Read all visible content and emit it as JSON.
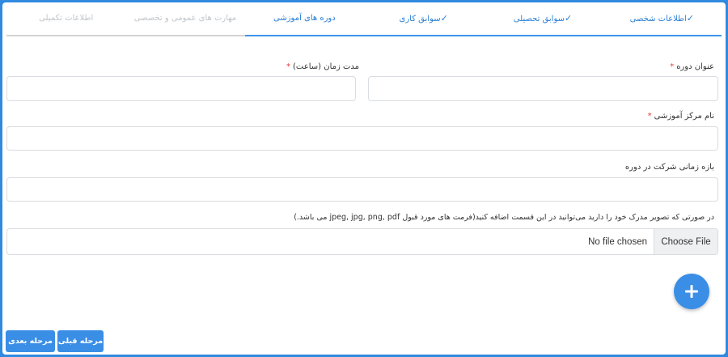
{
  "tabs": [
    {
      "label": "اطلاعات شخصی",
      "check": "✓",
      "state": "done"
    },
    {
      "label": "سوابق تحصیلی",
      "check": "✓",
      "state": "done"
    },
    {
      "label": "سوابق کاری",
      "check": "✓",
      "state": "done"
    },
    {
      "label": "دوره های آموزشی",
      "check": "",
      "state": "active"
    },
    {
      "label": "مهارت های عمومی و تخصصی",
      "check": "",
      "state": "pending"
    },
    {
      "label": "اطلاعات تکمیلی",
      "check": "",
      "state": "pending"
    }
  ],
  "form": {
    "course_title_label": "عنوان دوره",
    "duration_label": "مدت زمان (ساعت)",
    "center_label": "نام مرکز آموزشی",
    "period_label": "بازه زمانی شرکت در دوره",
    "required_mark": "*",
    "upload_hint": "در صورتی که تصویر مدرک خود را دارید می‌توانید در این قسمت اضافه کنید(فرمت های مورد قبول jpeg, jpg, png, pdf می باشد.)",
    "choose_file": "Choose File",
    "no_file": "No file chosen"
  },
  "footer": {
    "prev_label": "مرحله قبلی",
    "next_label": "مرحله بعدی"
  },
  "colors": {
    "accent": "#3a8ee6",
    "required": "#e53935"
  }
}
